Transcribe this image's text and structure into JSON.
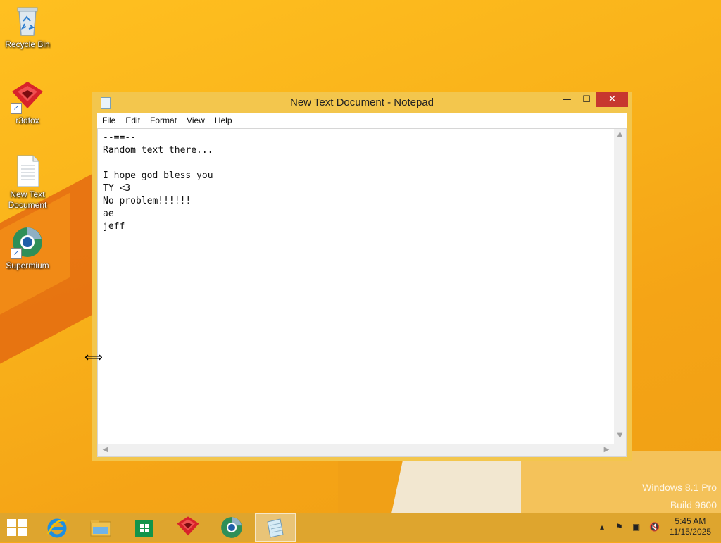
{
  "desktop": {
    "icons": [
      {
        "label": "Recycle Bin"
      },
      {
        "label": "r3dfox"
      },
      {
        "label": "New Text Document"
      },
      {
        "label": "Supermium"
      }
    ],
    "watermark": {
      "line1": "Windows 8.1 Pro",
      "line2": "Build 9600"
    }
  },
  "notepad": {
    "title": "New Text Document - Notepad",
    "menu": [
      "File",
      "Edit",
      "Format",
      "View",
      "Help"
    ],
    "content": "--==--\nRandom text there...\n\nI hope god bless you\nTY <3\nNo problem!!!!!!\nae\njeff",
    "controls": {
      "minimize": "—",
      "maximize": "☐",
      "close": "✕"
    }
  },
  "taskbar": {
    "apps": [
      "Internet Explorer",
      "File Explorer",
      "Store",
      "r3dfox",
      "Supermium",
      "Notepad"
    ],
    "active_app": "Notepad",
    "time": "5:45 AM",
    "date": "11/15/2025"
  },
  "colors": {
    "desktop_bg": "#f9b21a",
    "window_frame": "#f3c64d",
    "close_button": "#c7372f",
    "taskbar": "#dea52e"
  }
}
